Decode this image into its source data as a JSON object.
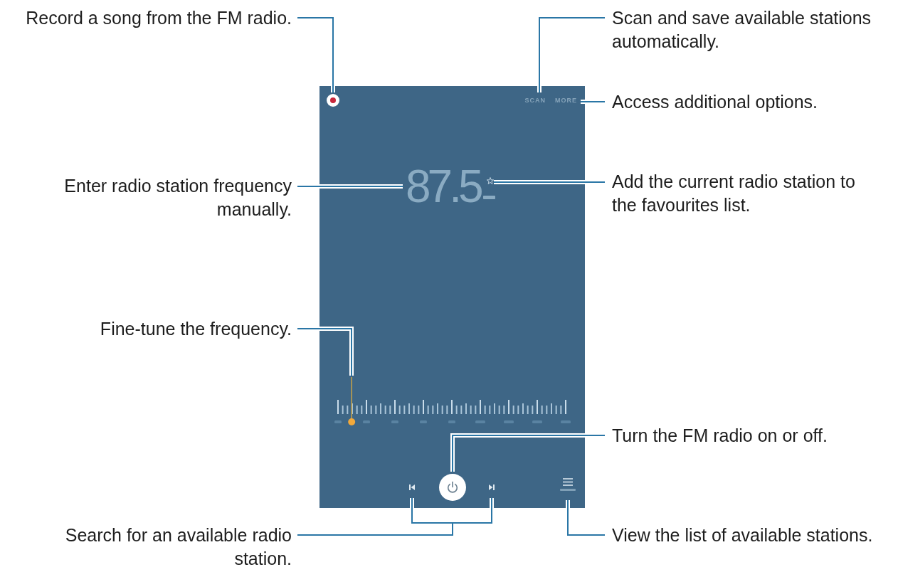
{
  "screen": {
    "actions": [
      "SCAN",
      "MORE"
    ],
    "frequency": "87.5",
    "favourite": false,
    "tuner": {
      "level": 0.06
    }
  },
  "callouts": [
    "Record a song from the FM radio.",
    "Scan and save available stations automatically.",
    "Access additional options.",
    "Enter radio station frequency manually.",
    "Add the current radio station to the favourites list.",
    "Fine-tune the frequency.",
    "Turn the FM radio on or off.",
    "Search for an available radio station.",
    "View the list of available stations."
  ]
}
